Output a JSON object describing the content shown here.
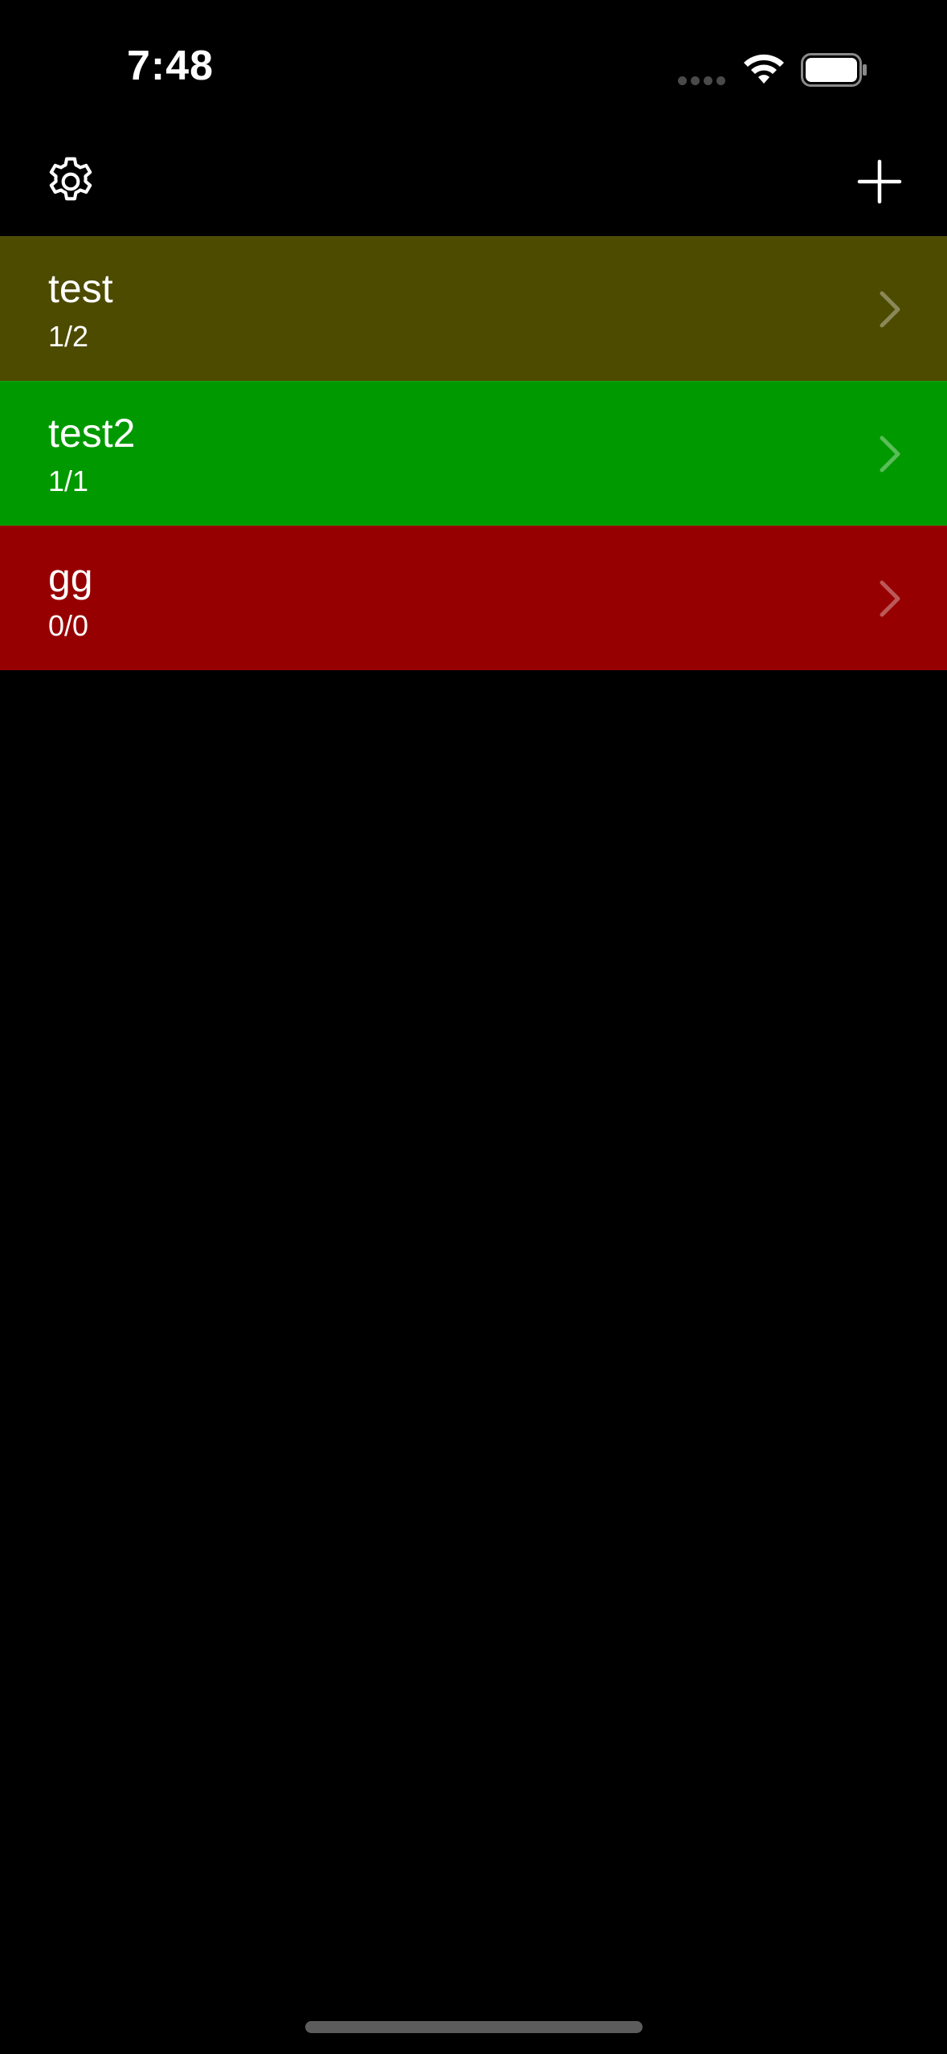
{
  "status_bar": {
    "time": "7:48",
    "signal_icon": "cellular-signal-dots-icon",
    "wifi_icon": "wifi-icon",
    "battery_icon": "battery-full-icon"
  },
  "nav": {
    "left_icon": "gear-icon",
    "right_icon": "plus-icon"
  },
  "items": [
    {
      "title": "test",
      "subtitle": "1/2",
      "color": "#4d4b00"
    },
    {
      "title": "test2",
      "subtitle": "1/1",
      "color": "#009a00"
    },
    {
      "title": "gg",
      "subtitle": "0/0",
      "color": "#970000"
    }
  ],
  "chevron_icon": "chevron-right-icon"
}
